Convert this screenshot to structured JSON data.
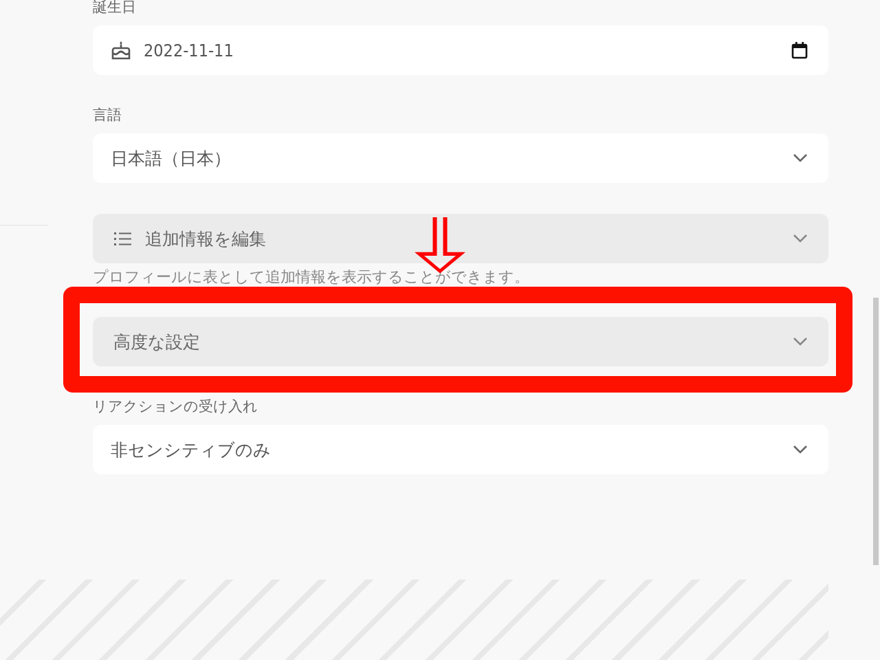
{
  "settings": [
    {
      "kind": "date",
      "label": "誕生日",
      "value": "2022-11-11"
    },
    {
      "kind": "select",
      "label": "言語",
      "value": "日本語（日本）"
    },
    {
      "kind": "button",
      "text": "追加情報を編集",
      "caption": "プロフィールに表として追加情報を表示することができます。",
      "arrow_below": true
    },
    {
      "kind": "folder",
      "text": "高度な設定",
      "highlighted": true
    },
    {
      "kind": "select",
      "label": "リアクションの受け入れ",
      "value": "非センシティブのみ"
    }
  ]
}
